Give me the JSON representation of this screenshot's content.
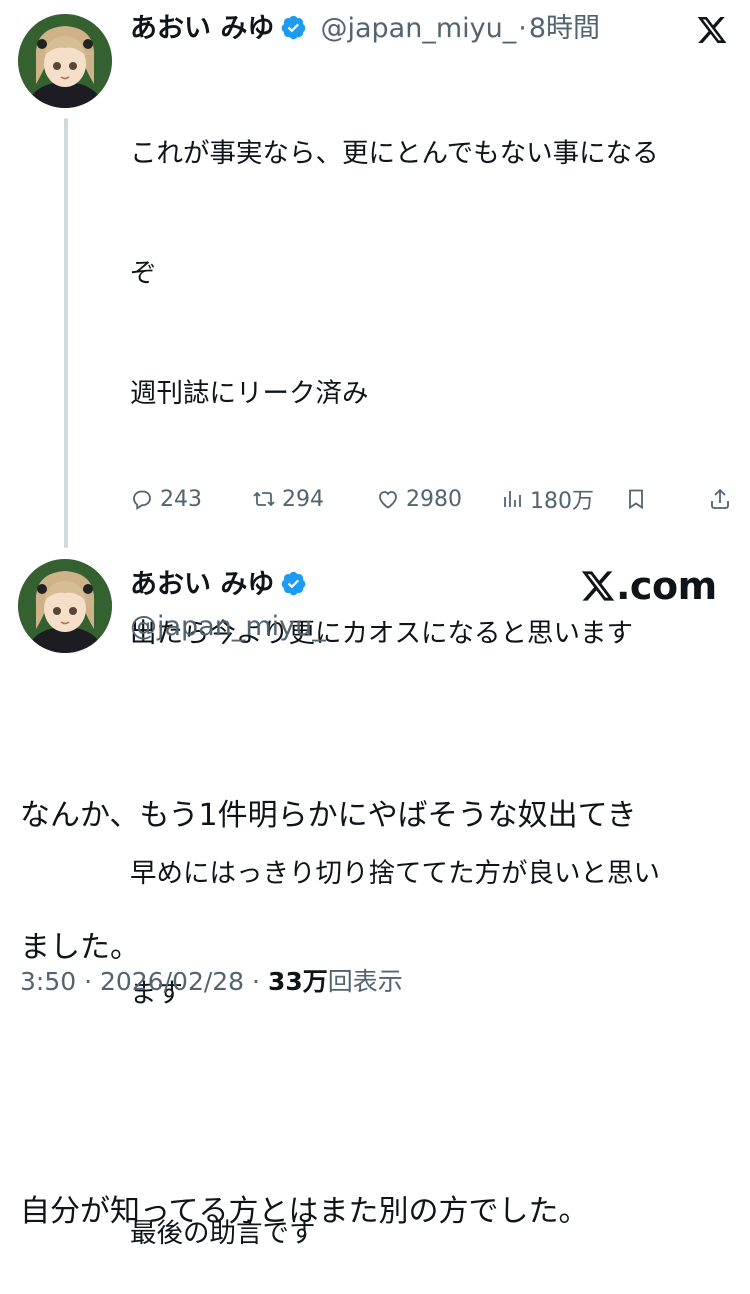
{
  "reply_tweet": {
    "display_name": "あおい みゆ",
    "handle": "@japan_miyu_",
    "separator": "·",
    "time_ago": "8時間",
    "lines": [
      "これが事実なら、更にとんでもない事になる",
      "ぞ",
      "週刊誌にリーク済み",
      "",
      "出たら今より更にカオスになると思います",
      "",
      "早めにはっきり切り捨ててた方が良いと思い",
      "ます",
      "",
      "最後の助言です"
    ],
    "stats": {
      "replies": "243",
      "retweets": "294",
      "likes": "2980",
      "views": "180万"
    }
  },
  "main_tweet": {
    "display_name": "あおい みゆ",
    "handle": "@japan_miyu_",
    "watermark": ".com",
    "lines": [
      "なんか、もう1件明らかにやばそうな奴出てき",
      "ました。",
      "",
      "自分が知ってる方とはまた別の方でした。"
    ],
    "footer": {
      "time": "3:50",
      "separator": "·",
      "date": "2026/02/28",
      "separator2": "·",
      "views_count": "33万",
      "views_label": "回表示"
    }
  },
  "colors": {
    "verified": "#1d9bf0",
    "muted": "#536471",
    "text": "#0f1419",
    "thread_line": "#cfd9de"
  },
  "icons": [
    "x-logo-icon",
    "verified-badge-icon",
    "reply-icon",
    "retweet-icon",
    "like-icon",
    "views-icon",
    "bookmark-icon",
    "share-icon"
  ]
}
